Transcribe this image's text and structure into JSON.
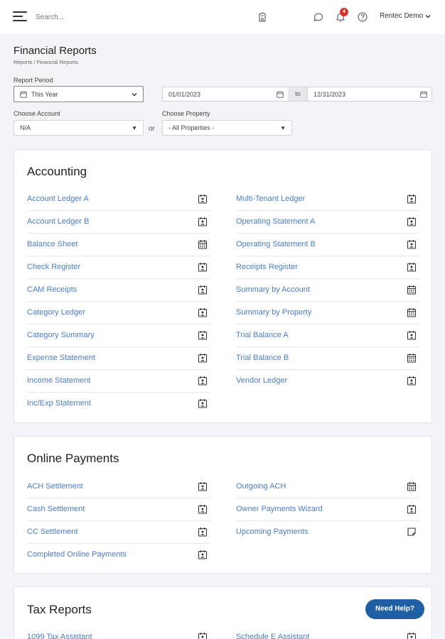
{
  "header": {
    "search_placeholder": "Search...",
    "notification_count": "4",
    "user_name": "Rentec Demo"
  },
  "page": {
    "title": "Financial Reports",
    "breadcrumb": "Reports / Financial Reports"
  },
  "filters": {
    "report_period_label": "Report Period",
    "period_value": "This Year",
    "start_date": "01/01/2023",
    "to_label": "to",
    "end_date": "12/31/2023",
    "account_label": "Choose Account",
    "account_value": "N/A",
    "or_label": "or",
    "property_label": "Choose Property",
    "property_value": "- All Properties -"
  },
  "sections": {
    "accounting": {
      "title": "Accounting",
      "left": [
        {
          "label": "Account Ledger A",
          "icon": "person-calendar-icon"
        },
        {
          "label": "Account Ledger B",
          "icon": "person-calendar-icon"
        },
        {
          "label": "Balance Sheet",
          "icon": "calendar-grid-icon"
        },
        {
          "label": "Check Register",
          "icon": "person-calendar-icon"
        },
        {
          "label": "CAM Receipts",
          "icon": "person-calendar-icon"
        },
        {
          "label": "Category Ledger",
          "icon": "person-calendar-icon"
        },
        {
          "label": "Category Summary",
          "icon": "person-calendar-icon"
        },
        {
          "label": "Expense Statement",
          "icon": "person-calendar-icon"
        },
        {
          "label": "Income Statement",
          "icon": "person-calendar-icon"
        },
        {
          "label": "Inc/Exp Statement",
          "icon": "person-calendar-icon"
        }
      ],
      "right": [
        {
          "label": "Multi-Tenant Ledger",
          "icon": "person-calendar-icon"
        },
        {
          "label": "Operating Statement A",
          "icon": "person-calendar-icon"
        },
        {
          "label": "Operating Statement B",
          "icon": "person-calendar-icon"
        },
        {
          "label": "Receipts Register",
          "icon": "person-calendar-icon"
        },
        {
          "label": "Summary by Account",
          "icon": "calendar-grid-icon"
        },
        {
          "label": "Summary by Property",
          "icon": "calendar-grid-icon"
        },
        {
          "label": "Trial Balance A",
          "icon": "person-calendar-icon"
        },
        {
          "label": "Trial Balance B",
          "icon": "calendar-grid-icon"
        },
        {
          "label": "Vendor Ledger",
          "icon": "person-calendar-icon"
        }
      ]
    },
    "online_payments": {
      "title": "Online Payments",
      "left": [
        {
          "label": "ACH Settlement",
          "icon": "person-calendar-icon"
        },
        {
          "label": "Cash Settlement",
          "icon": "person-calendar-icon"
        },
        {
          "label": "CC Settlement",
          "icon": "person-calendar-icon"
        },
        {
          "label": "Completed Online Payments",
          "icon": "person-calendar-icon"
        }
      ],
      "right": [
        {
          "label": "Outgoing ACH",
          "icon": "calendar-grid-icon"
        },
        {
          "label": "Owner Payments Wizard",
          "icon": "person-calendar-icon"
        },
        {
          "label": "Upcoming Payments",
          "icon": "note-icon"
        }
      ]
    },
    "tax_reports": {
      "title": "Tax Reports",
      "left": [
        {
          "label": "1099 Tax Assistant",
          "icon": "person-calendar-icon"
        }
      ],
      "right": [
        {
          "label": "Schedule E Assistant",
          "icon": "person-calendar-icon"
        }
      ]
    }
  },
  "help_button_label": "Need Help?",
  "colors": {
    "link": "#4a7cc9",
    "help_button": "#1f5fa3",
    "badge": "#d9302c"
  }
}
